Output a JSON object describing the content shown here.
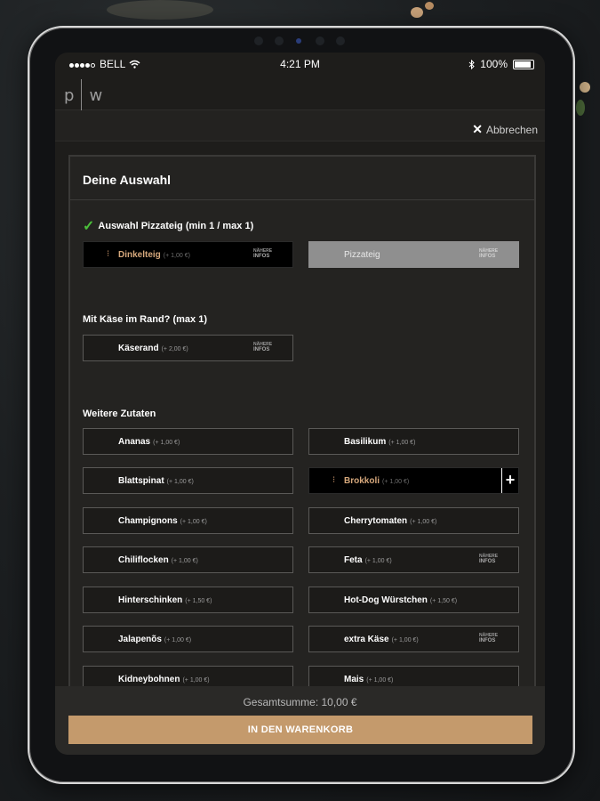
{
  "status_bar": {
    "carrier": "BELL",
    "time": "4:21 PM",
    "battery": "100%",
    "icons": [
      "signal-dots-icon",
      "wifi-icon",
      "bluetooth-icon",
      "battery-icon"
    ]
  },
  "header": {
    "logo_left": "p",
    "logo_right": "w",
    "cancel_label": "Abbrechen",
    "cancel_icon": "close-icon"
  },
  "panel": {
    "title": "Deine Auswahl",
    "sections": [
      {
        "label": "Auswahl Pizzateig (min 1 / max 1)",
        "checked": true,
        "options": [
          {
            "name": "Dinkelteig",
            "price": "(+ 1,00 €)",
            "state": "selected",
            "info": {
              "top": "NÄHERE",
              "bottom": "INFOS"
            }
          },
          {
            "name": "Pizzateig",
            "price": "",
            "state": "disabled",
            "info": {
              "top": "NÄHERE",
              "bottom": "INFOS"
            }
          }
        ]
      },
      {
        "label": "Mit Käse im Rand? (max 1)",
        "checked": false,
        "options": [
          {
            "name": "Käserand",
            "price": "(+ 2,00 €)",
            "state": "normal",
            "info": {
              "top": "NÄHERE",
              "bottom": "INFOS"
            }
          }
        ]
      },
      {
        "label": "Weitere Zutaten",
        "checked": false,
        "options": [
          {
            "name": "Ananas",
            "price": "(+ 1,00 €)",
            "state": "normal"
          },
          {
            "name": "Basilikum",
            "price": "(+ 1,00 €)",
            "state": "normal"
          },
          {
            "name": "Blattspinat",
            "price": "(+ 1,00 €)",
            "state": "normal"
          },
          {
            "name": "Brokkoli",
            "price": "(+ 1,00 €)",
            "state": "selected",
            "plus": "+"
          },
          {
            "name": "Champignons",
            "price": "(+ 1,00 €)",
            "state": "normal"
          },
          {
            "name": "Cherrytomaten",
            "price": "(+ 1,00 €)",
            "state": "normal"
          },
          {
            "name": "Chiliflocken",
            "price": "(+ 1,00 €)",
            "state": "normal"
          },
          {
            "name": "Feta",
            "price": "(+ 1,00 €)",
            "state": "normal",
            "info": {
              "top": "NÄHERE",
              "bottom": "INFOS"
            }
          },
          {
            "name": "Hinterschinken",
            "price": "(+ 1,50 €)",
            "state": "normal"
          },
          {
            "name": "Hot-Dog Würstchen",
            "price": "(+ 1,50 €)",
            "state": "normal"
          },
          {
            "name": "Jalapenõs",
            "price": "(+ 1,00 €)",
            "state": "normal"
          },
          {
            "name": "extra Käse",
            "price": "(+ 1,00 €)",
            "state": "normal",
            "info": {
              "top": "NÄHERE",
              "bottom": "INFOS"
            }
          },
          {
            "name": "Kidneybohnen",
            "price": "(+ 1,00 €)",
            "state": "normal"
          },
          {
            "name": "Mais",
            "price": "(+ 1,00 €)",
            "state": "normal"
          }
        ]
      }
    ]
  },
  "footer": {
    "total": "Gesamtsumme: 10,00 €",
    "cart_button": "IN DEN WARENKORB"
  },
  "colors": {
    "accent": "#c49a6c",
    "selected_text": "#d6a87c",
    "check": "#4bbf3a",
    "panel_bg": "#242321"
  }
}
